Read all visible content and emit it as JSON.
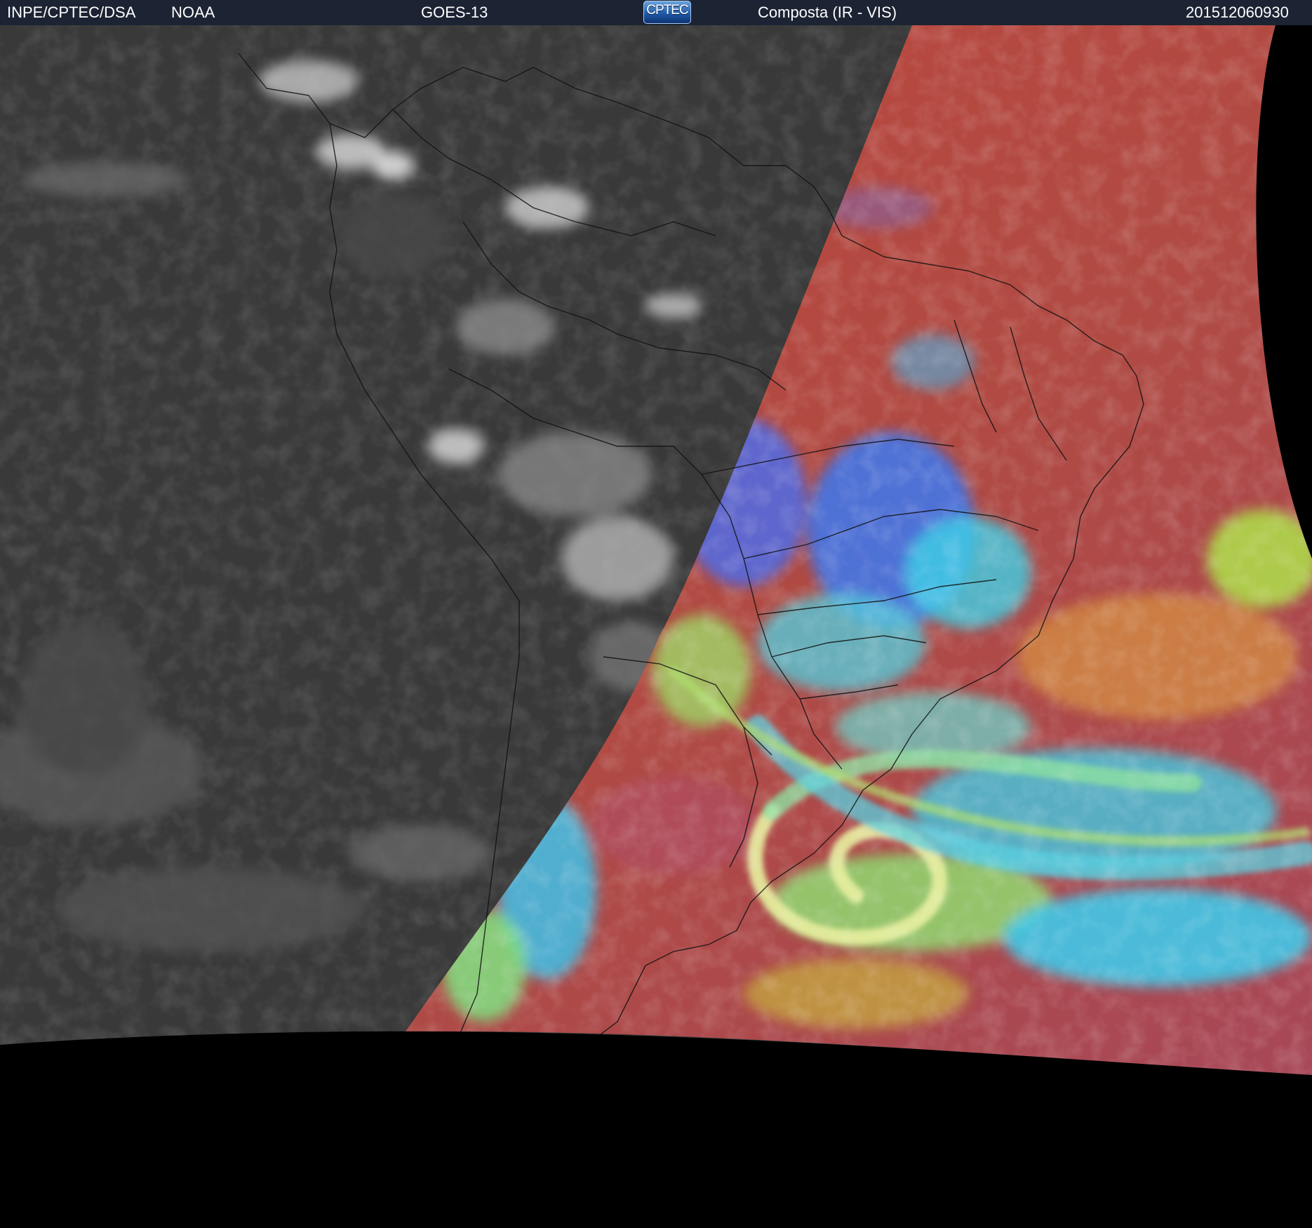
{
  "header": {
    "org": "INPE/CPTEC/DSA",
    "agency": "NOAA",
    "satellite": "GOES-13",
    "logo_text": "CPTEC",
    "product": "Composta (IR - VIS)",
    "timestamp": "201512060930"
  },
  "colors": {
    "header_bg": "#1c2333",
    "night_side": "#3a3a3a",
    "day_side_clear": "#b8483c",
    "cloud_cyan": "#3ed0e6",
    "cloud_green": "#9ee06a",
    "cloud_blue": "#3c78f0",
    "space": "#000000"
  }
}
